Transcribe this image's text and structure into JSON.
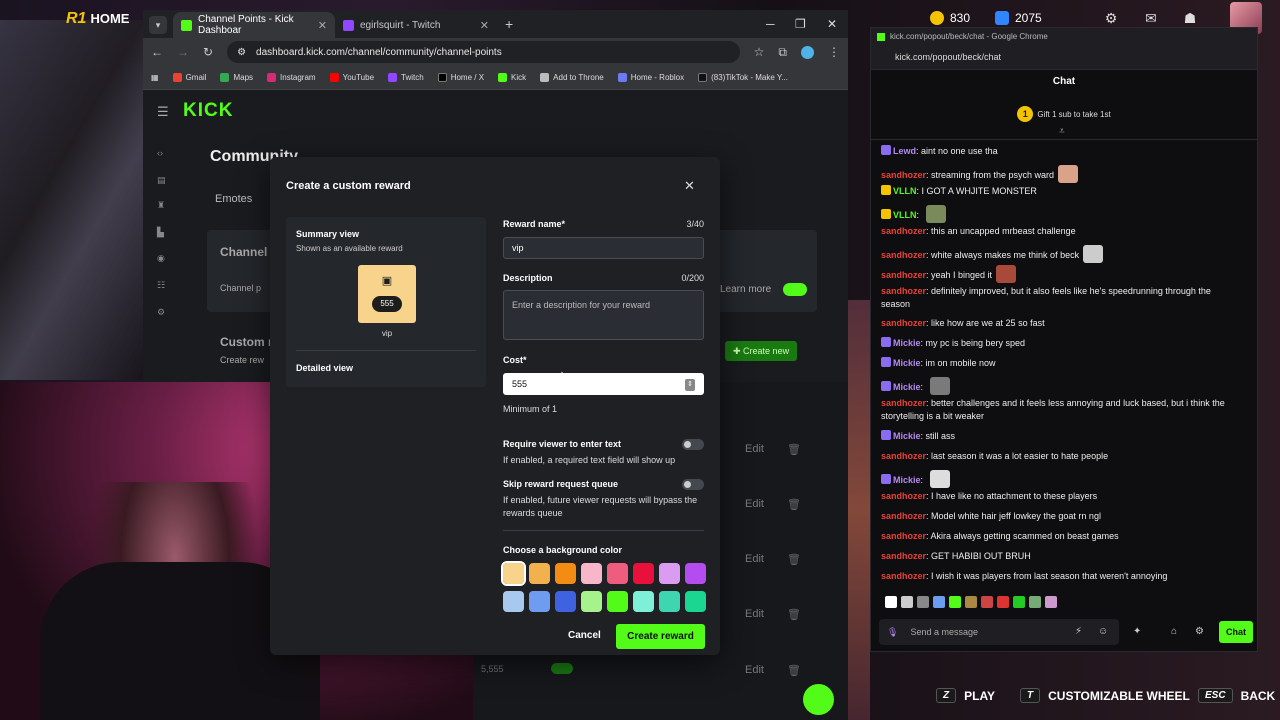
{
  "overlay": {
    "home_label": "HOME",
    "logo": "R1",
    "coins": "830",
    "gems": "2075",
    "bottom_hints": [
      {
        "key": "Z",
        "label": "PLAY"
      },
      {
        "key": "T",
        "label": "CUSTOMIZABLE WHEEL"
      },
      {
        "key": "ESC",
        "label": "BACK"
      }
    ]
  },
  "browser": {
    "tabs": [
      {
        "label": "Channel Points - Kick Dashboar",
        "color": "#53fc18"
      },
      {
        "label": "egirlsquirt - Twitch",
        "color": "#9146ff"
      }
    ],
    "url": "dashboard.kick.com/channel/community/channel-points",
    "bookmarks": [
      "Gmail",
      "Maps",
      "Instagram",
      "YouTube",
      "Twitch",
      "Home / X",
      "Kick",
      "Add to Throne",
      "Home - Roblox",
      "(83)TikTok - Make Y..."
    ]
  },
  "dashboard": {
    "logo": "KICK",
    "title": "Community",
    "tab_emotes": "Emotes",
    "section_channel": "Channel",
    "section_channel_sub": "Channel p",
    "section_custom": "Custom r",
    "section_custom_sub": "Create rew",
    "learn_more": "Learn more",
    "create_new": "Create new",
    "edit_label": "Edit",
    "last_cost": "5,555"
  },
  "modal": {
    "title": "Create a custom reward",
    "summary_title": "Summary view",
    "summary_sub": "Shown as an available reward",
    "reward_cost": "555",
    "reward_label": "vip",
    "detailed_title": "Detailed view",
    "reward_name_label": "Reward name*",
    "reward_name_count": "3/40",
    "reward_name_value": "vip",
    "description_label": "Description",
    "description_count": "0/200",
    "description_placeholder": "Enter a description for your reward",
    "cost_label": "Cost*",
    "cost_value": "555",
    "cost_help": "Minimum of 1",
    "require_text_label": "Require viewer to enter text",
    "require_text_help": "If enabled, a required text field will show up",
    "skip_queue_label": "Skip reward request queue",
    "skip_queue_help": "If enabled, future viewer requests will bypass the rewards queue",
    "bg_color_label": "Choose a background color",
    "colors_row1": [
      "#f7d38b",
      "#f2b14c",
      "#f28c12",
      "#f7b6c9",
      "#ee5c7e",
      "#e8113c",
      "#d99cf0",
      "#b44cf0"
    ],
    "colors_row2": [
      "#a9c8f0",
      "#6f9cf0",
      "#3f63e0",
      "#a6f28c",
      "#53fc18",
      "#7ef0d8",
      "#3ed6b0",
      "#1ad690"
    ],
    "cancel": "Cancel",
    "create": "Create reward"
  },
  "chat": {
    "window_title": "kick.com/popout/beck/chat - Google Chrome",
    "url": "kick.com/popout/beck/chat",
    "header": "Chat",
    "gift_text": "Gift 1 sub to take 1st",
    "gift_number": "1",
    "messages": [
      {
        "user": "Lewd",
        "color": "#b589f0",
        "text": "aint no one use tha"
      },
      {
        "user": "sandhozer",
        "color": "#e8413a",
        "text": "streaming from the psych ward"
      },
      {
        "user": "VLLN",
        "color": "#53fc18",
        "text": "I GOT A WHJITE MONSTER"
      },
      {
        "user": "VLLN",
        "color": "#53fc18",
        "text": ""
      },
      {
        "user": "sandhozer",
        "color": "#e8413a",
        "text": "this an uncapped mrbeast challenge"
      },
      {
        "user": "sandhozer",
        "color": "#e8413a",
        "text": "white  always makes me think of beck"
      },
      {
        "user": "sandhozer",
        "color": "#e8413a",
        "text": "yeah I binged it"
      },
      {
        "user": "sandhozer",
        "color": "#e8413a",
        "text": "definitely improved, but it also feels like he's speedrunning through the season"
      },
      {
        "user": "sandhozer",
        "color": "#e8413a",
        "text": "like how are we at 25 so fast"
      },
      {
        "user": "Mickie",
        "color": "#b589f0",
        "text": "my pc is being bery sped"
      },
      {
        "user": "Mickie",
        "color": "#b589f0",
        "text": "im on mobile now"
      },
      {
        "user": "Mickie",
        "color": "#b589f0",
        "text": ""
      },
      {
        "user": "sandhozer",
        "color": "#e8413a",
        "text": "better challenges and it feels less annoying and luck based, but i think the storytelling is a bit weaker"
      },
      {
        "user": "Mickie",
        "color": "#b589f0",
        "text": "still ass"
      },
      {
        "user": "sandhozer",
        "color": "#e8413a",
        "text": "last season it was a lot easier to hate people"
      },
      {
        "user": "Mickie",
        "color": "#b589f0",
        "text": ""
      },
      {
        "user": "sandhozer",
        "color": "#e8413a",
        "text": "I have like no attachment to these players"
      },
      {
        "user": "sandhozer",
        "color": "#e8413a",
        "text": "Model white hair jeff lowkey the goat rn ngl"
      },
      {
        "user": "sandhozer",
        "color": "#e8413a",
        "text": "Akira always getting scammed on beast games"
      },
      {
        "user": "sandhozer",
        "color": "#e8413a",
        "text": "GET HABIBI OUT BRUH"
      },
      {
        "user": "sandhozer",
        "color": "#e8413a",
        "text": "I wish it was players from last season that weren't annoying"
      }
    ],
    "input_placeholder": "Send a message",
    "send_label": "Chat"
  }
}
